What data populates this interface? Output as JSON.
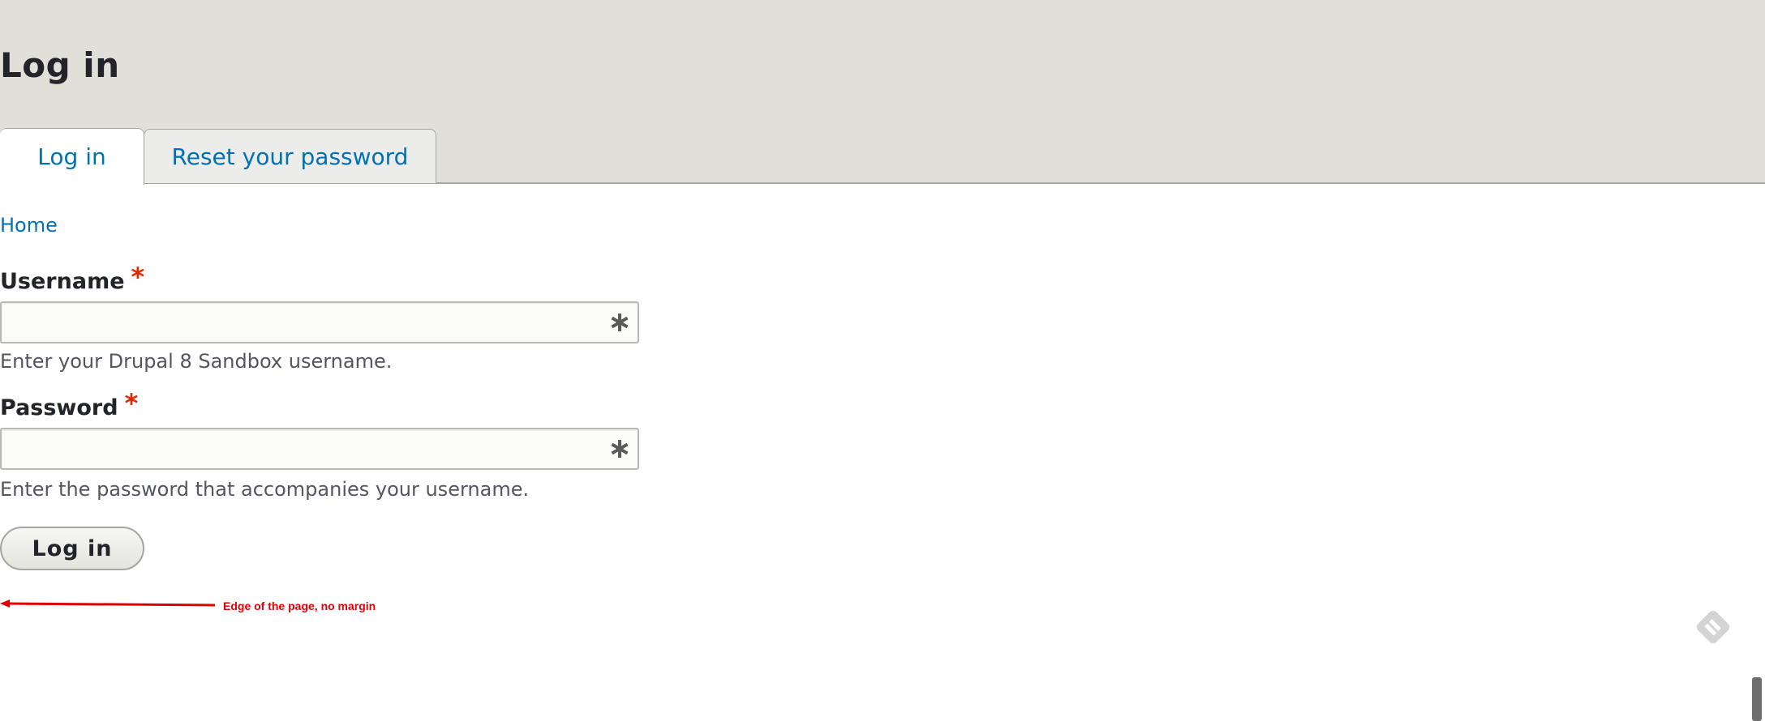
{
  "page": {
    "title": "Log in"
  },
  "tabs": [
    {
      "label": "Log in",
      "active": true
    },
    {
      "label": "Reset your password",
      "active": false
    }
  ],
  "breadcrumb": {
    "home": "Home"
  },
  "form": {
    "username": {
      "label": "Username",
      "required_marker": "*",
      "value": "",
      "description": "Enter your Drupal 8 Sandbox username.",
      "icon": "required-asterisk-icon"
    },
    "password": {
      "label": "Password",
      "required_marker": "*",
      "value": "",
      "description": "Enter the password that accompanies your username.",
      "icon": "required-asterisk-icon"
    },
    "submit_label": "Log in"
  },
  "annotation": {
    "text": "Edge of the page, no margin",
    "color": "#e00000"
  },
  "colors": {
    "header_bg": "#e0e0d8",
    "link": "#0071b3",
    "required": "#e62600",
    "text": "#232429"
  },
  "icons": {
    "feedback": "feedback-pencil-icon"
  }
}
